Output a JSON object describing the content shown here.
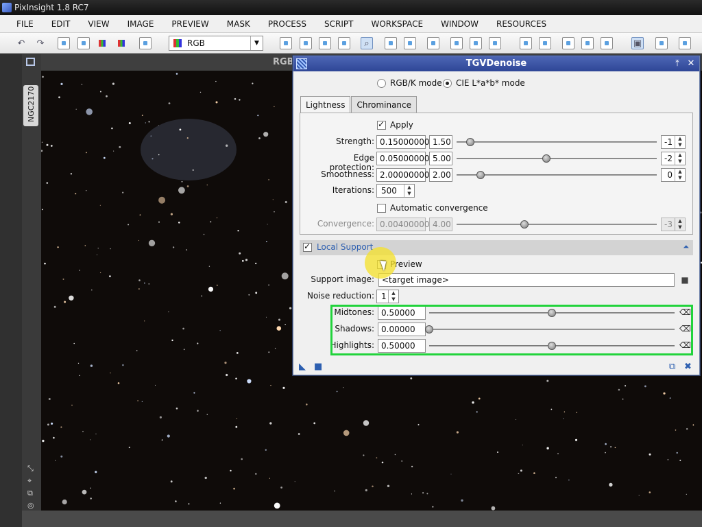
{
  "app": {
    "title": "PixInsight 1.8 RC7"
  },
  "menu": [
    "FILE",
    "EDIT",
    "VIEW",
    "IMAGE",
    "PREVIEW",
    "MASK",
    "PROCESS",
    "SCRIPT",
    "WORKSPACE",
    "WINDOW",
    "RESOURCES"
  ],
  "toolbar": {
    "channel_select": "RGB",
    "icons": [
      "undo-icon",
      "redo-icon",
      "new-view-icon",
      "new-document-icon",
      "color-icon",
      "color-icon-2",
      "add-preview-icon",
      "magnifier-icon"
    ]
  },
  "image": {
    "id_tab": "NGC2170",
    "header_label": "RGB"
  },
  "dialog": {
    "title": "TGVDenoise",
    "mode": {
      "rgbk_label": "RGB/K mode",
      "cie_label": "CIE L*a*b* mode",
      "selected": "cie"
    },
    "tabs": [
      "Lightness",
      "Chrominance"
    ],
    "active_tab": "Lightness",
    "apply": {
      "label": "Apply",
      "checked": true
    },
    "params": [
      {
        "label": "Strength:",
        "value": "0.15000000",
        "short": "1.50",
        "slider_pos": 0.07,
        "exp": "-1"
      },
      {
        "label": "Edge protection:",
        "value": "0.05000000",
        "short": "5.00",
        "slider_pos": 0.45,
        "exp": "-2"
      },
      {
        "label": "Smoothness:",
        "value": "2.00000000",
        "short": "2.00",
        "slider_pos": 0.12,
        "exp": "0"
      }
    ],
    "iterations": {
      "label": "Iterations:",
      "value": "500"
    },
    "auto_convergence": {
      "label": "Automatic convergence",
      "checked": false
    },
    "convergence": {
      "label": "Convergence:",
      "value": "0.00400000",
      "short": "4.00",
      "slider_pos": 0.34,
      "exp": "-3"
    },
    "local_support": {
      "title": "Local Support",
      "enabled": true,
      "preview": {
        "label": "Preview",
        "checked": false
      },
      "support_image": {
        "label": "Support image:",
        "value": "<target image>"
      },
      "noise_reduction": {
        "label": "Noise reduction:",
        "value": "1"
      },
      "midtones": {
        "label": "Midtones:",
        "value": "0.50000",
        "slider_pos": 0.5
      },
      "shadows": {
        "label": "Shadows:",
        "value": "0.00000",
        "slider_pos": 0.0
      },
      "highlights": {
        "label": "Highlights:",
        "value": "0.50000",
        "slider_pos": 0.5
      }
    }
  },
  "colors": {
    "accent": "#2d5fb0",
    "highlight": "#21d33b",
    "title_bar": "#3a52a3",
    "cursor_halo": "#f5e128"
  }
}
